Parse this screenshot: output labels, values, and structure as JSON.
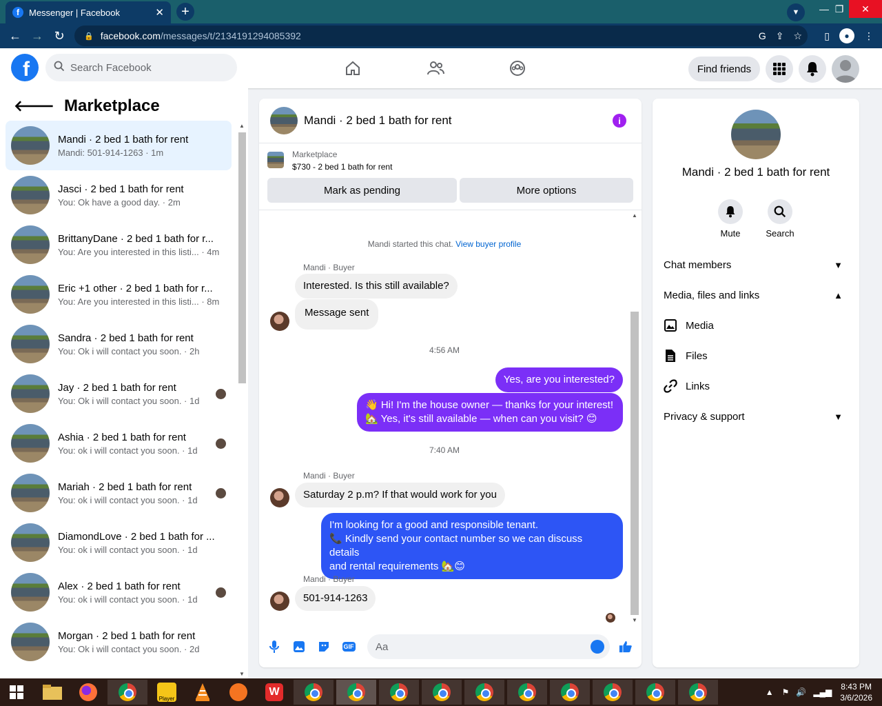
{
  "browser": {
    "tab_title": "Messenger | Facebook",
    "tab_close": "✕",
    "new_tab": "+",
    "url_host": "facebook.com",
    "url_path": "/messages/t/2134191294085392",
    "window_controls": [
      "—",
      "❐",
      "✕"
    ]
  },
  "fb": {
    "logo": "f",
    "search_placeholder": "Search Facebook",
    "find_friends": "Find friends"
  },
  "left": {
    "title": "Marketplace",
    "conversations": [
      {
        "title": "Mandi · 2 bed 1 bath for rent",
        "sub": "Mandi: 501-914-1263 · 1m",
        "active": true,
        "seen": false
      },
      {
        "title": "Jasci · 2 bed 1 bath for rent",
        "sub": "You: Ok have a good day. · 2m",
        "active": false,
        "seen": false
      },
      {
        "title": "BrittanyDane · 2 bed 1 bath for r...",
        "sub": "You: Are you interested in this listi... · 4m",
        "active": false,
        "seen": false
      },
      {
        "title": "Eric +1 other · 2 bed 1 bath for r...",
        "sub": "You: Are you interested in this listi... · 8m",
        "active": false,
        "seen": false
      },
      {
        "title": "Sandra · 2 bed 1 bath for rent",
        "sub": "You: Ok i will contact you soon. · 2h",
        "active": false,
        "seen": false
      },
      {
        "title": "Jay · 2 bed 1 bath for rent",
        "sub": "You: Ok i will contact you soon. · 1d",
        "active": false,
        "seen": true
      },
      {
        "title": "Ashia · 2 bed 1 bath for rent",
        "sub": "You: ok i will contact you soon. · 1d",
        "active": false,
        "seen": true
      },
      {
        "title": "Mariah · 2 bed 1 bath for rent",
        "sub": "You: ok i will contact you soon. · 1d",
        "active": false,
        "seen": true
      },
      {
        "title": "DiamondLove · 2 bed 1 bath for ...",
        "sub": "You: ok i will contact you soon. · 1d",
        "active": false,
        "seen": false
      },
      {
        "title": "Alex · 2 bed 1 bath for rent",
        "sub": "You: ok i will contact you soon. · 1d",
        "active": false,
        "seen": true
      },
      {
        "title": "Morgan · 2 bed 1 bath for rent",
        "sub": "You: Ok i will contact you soon. · 2d",
        "active": false,
        "seen": false
      }
    ]
  },
  "chat": {
    "title": "Mandi · 2 bed 1 bath for rent",
    "marketplace_label": "Marketplace",
    "listing": "$730 - 2 bed 1 bath for rent",
    "mark_pending": "Mark as pending",
    "more_options": "More options",
    "started": "Mandi started this chat.",
    "view_profile": "View buyer profile",
    "sender": "Mandi · Buyer",
    "msg1": "Interested. Is this still available?",
    "msg2": "Message sent",
    "time1": "4:56 AM",
    "out1": "Yes, are you interested?",
    "out2_line1": "👋 Hi! I'm the house owner — thanks for your interest!",
    "out2_line2": "🏡 Yes, it's still available — when can you visit? 😊",
    "time2": "7:40 AM",
    "msg3": "Saturday 2 p.m? If that would work for you",
    "out3_line1": "I'm looking for a good and responsible tenant.",
    "out3_line2": "📞 Kindly send your contact number so we can discuss details",
    "out3_line3": "and rental requirements 🏡😊",
    "msg4": "501-914-1263",
    "composer_placeholder": "Aa",
    "gif_label": "GIF"
  },
  "right": {
    "name": "Mandi · 2 bed 1 bath for rent",
    "mute": "Mute",
    "search": "Search",
    "chat_members": "Chat members",
    "media_files_links": "Media, files and links",
    "media": "Media",
    "files": "Files",
    "links": "Links",
    "privacy": "Privacy & support"
  },
  "taskbar": {
    "time": "8:43 PM",
    "date": "3/6/2026",
    "player_label": "Player"
  },
  "colors": {
    "fb_blue": "#1877f2",
    "bubble_purple": "#7b2ff7",
    "bubble_blue": "#2d55f5",
    "active_bg": "#e7f3ff"
  }
}
